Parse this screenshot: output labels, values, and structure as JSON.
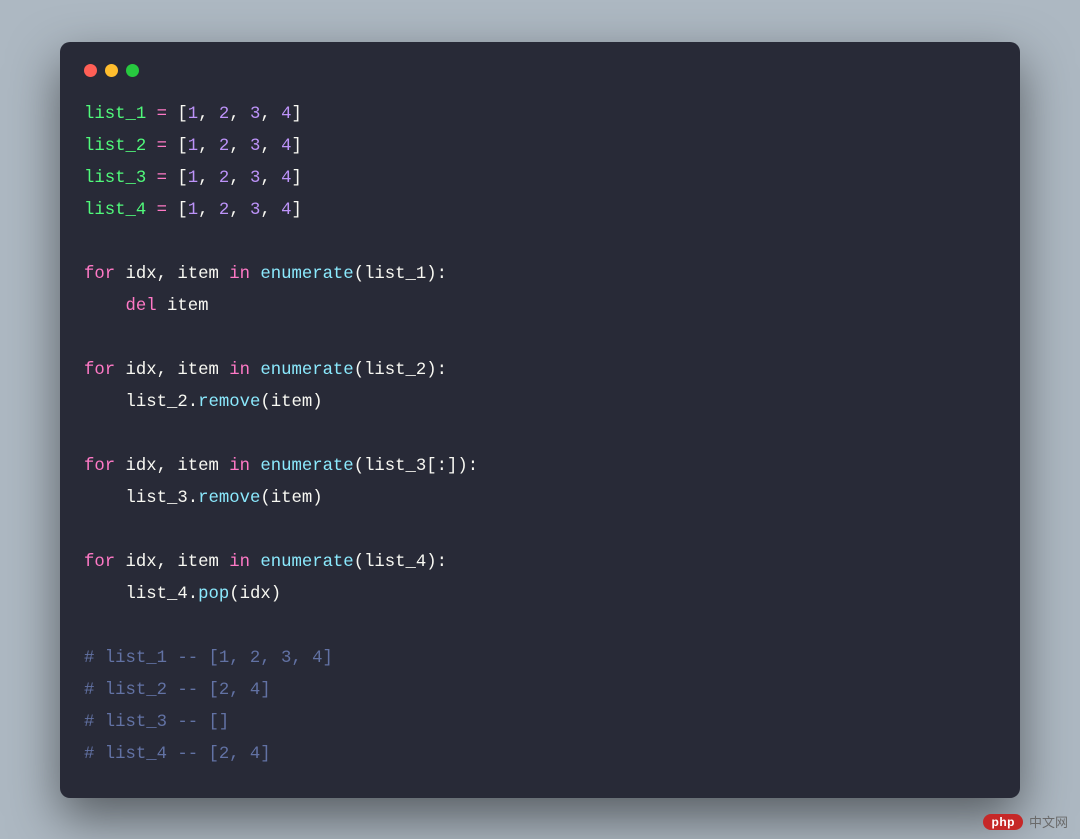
{
  "site": {
    "php": "php",
    "cn": "中文网"
  },
  "colors": {
    "bg": "#adb8c2",
    "window": "#282a37",
    "red": "#ff5f56",
    "yellow": "#ffbd2e",
    "green": "#27c93f"
  },
  "code": {
    "assign": [
      {
        "name": "list_1",
        "values": [
          "1",
          "2",
          "3",
          "4"
        ]
      },
      {
        "name": "list_2",
        "values": [
          "1",
          "2",
          "3",
          "4"
        ]
      },
      {
        "name": "list_3",
        "values": [
          "1",
          "2",
          "3",
          "4"
        ]
      },
      {
        "name": "list_4",
        "values": [
          "1",
          "2",
          "3",
          "4"
        ]
      }
    ],
    "loops": [
      {
        "for": "for",
        "vars": "idx, item",
        "in": "in",
        "fn": "enumerate",
        "arg": "list_1",
        "slice": "",
        "colon": ":",
        "body_kw": "del",
        "body_rest": "item",
        "body_call": null
      },
      {
        "for": "for",
        "vars": "idx, item",
        "in": "in",
        "fn": "enumerate",
        "arg": "list_2",
        "slice": "",
        "colon": ":",
        "body_target": "list_2",
        "body_method": "remove",
        "body_arg": "item"
      },
      {
        "for": "for",
        "vars": "idx, item",
        "in": "in",
        "fn": "enumerate",
        "arg": "list_3",
        "slice": "[:]",
        "colon": ":",
        "body_target": "list_3",
        "body_method": "remove",
        "body_arg": "item"
      },
      {
        "for": "for",
        "vars": "idx, item",
        "in": "in",
        "fn": "enumerate",
        "arg": "list_4",
        "slice": "",
        "colon": ":",
        "body_target": "list_4",
        "body_method": "pop",
        "body_arg": "idx"
      }
    ],
    "comments": [
      "# list_1 -- [1, 2, 3, 4]",
      "# list_2 -- [2, 4]",
      "# list_3 -- []",
      "# list_4 -- [2, 4]"
    ]
  }
}
